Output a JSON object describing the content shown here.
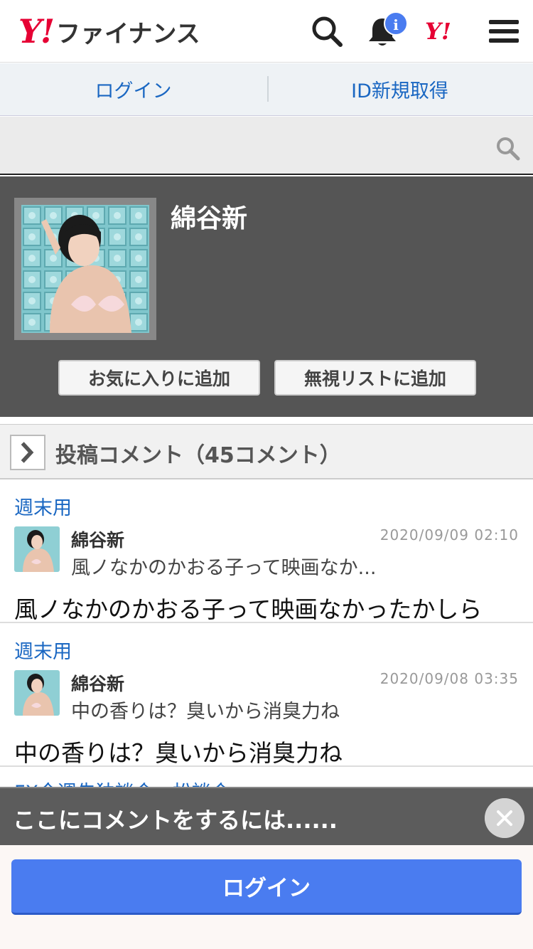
{
  "header": {
    "logo_mark": "Y!",
    "logo_text": "ファイナンス",
    "notification_badge": "i",
    "yahoo_mark": "Y!"
  },
  "auth": {
    "login_label": "ログイン",
    "signup_label": "ID新規取得"
  },
  "profile": {
    "name": "綿谷新",
    "favorite_button": "お気に入りに追加",
    "ignore_button": "無視リストに追加"
  },
  "comments_section": {
    "title": "投稿コメント（45コメント）"
  },
  "comments": [
    {
      "board": "週末用",
      "user": "綿谷新",
      "time": "2020/09/09 02:10",
      "preview": "風ノなかのかおる子って映画なか...",
      "body": "風ノなかのかおる子って映画なかったかしら"
    },
    {
      "board": "週末用",
      "user": "綿谷新",
      "time": "2020/09/08 03:35",
      "preview": "中の香りは？臭いから消臭力ね",
      "body": "中の香りは？臭いから消臭力ね"
    }
  ],
  "partial_comment_board": "FX今週先独談会・松談会",
  "overlay": {
    "prompt": "ここにコメントをするには......",
    "login_button": "ログイン"
  },
  "colors": {
    "brand_red": "#e60033",
    "link_blue": "#1a67c2",
    "button_blue": "#4a7cf0"
  }
}
